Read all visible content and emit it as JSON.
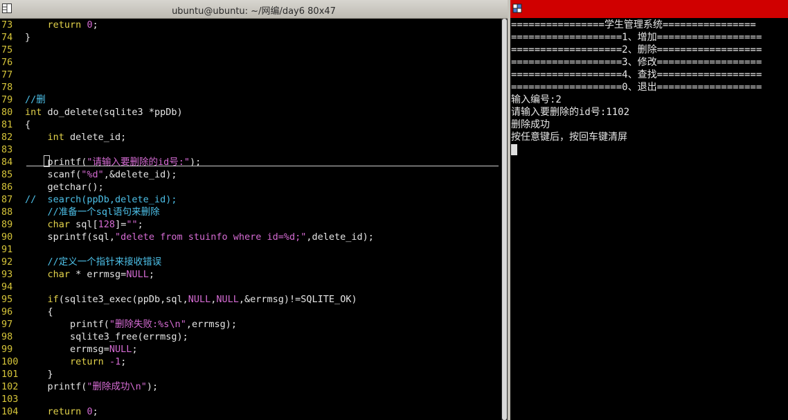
{
  "window": {
    "title": "ubuntu@ubuntu: ~/网编/day6 80x47"
  },
  "colors": {
    "right_titlebar": "#d00000",
    "line_number": "#d7c63a",
    "keyword": "#e3d34b",
    "string": "#d56bd3",
    "comment": "#4dc0e8"
  },
  "code_lines": [
    {
      "n": "73",
      "parts": [
        [
          "ct",
          "    "
        ],
        [
          "kw",
          "return"
        ],
        [
          "ct",
          " "
        ],
        [
          "num",
          "0"
        ],
        [
          "ct",
          ";"
        ]
      ]
    },
    {
      "n": "74",
      "parts": [
        [
          "ct",
          "}"
        ]
      ]
    },
    {
      "n": "75",
      "parts": []
    },
    {
      "n": "76",
      "parts": []
    },
    {
      "n": "77",
      "parts": []
    },
    {
      "n": "78",
      "parts": []
    },
    {
      "n": "79",
      "parts": [
        [
          "cmt",
          "//删"
        ]
      ]
    },
    {
      "n": "80",
      "parts": [
        [
          "kw",
          "int"
        ],
        [
          "ct",
          " do_delete(sqlite3 *ppDb)"
        ]
      ]
    },
    {
      "n": "81",
      "parts": [
        [
          "ct",
          "{"
        ]
      ]
    },
    {
      "n": "82",
      "parts": [
        [
          "ct",
          "    "
        ],
        [
          "kw",
          "int"
        ],
        [
          "ct",
          " delete_id;"
        ]
      ]
    },
    {
      "n": "83",
      "parts": []
    },
    {
      "n": "84",
      "parts": [
        [
          "ct",
          "    printf("
        ],
        [
          "str",
          "\"请输入要删除的id号:\""
        ],
        [
          "ct",
          ");"
        ]
      ]
    },
    {
      "n": "85",
      "parts": [
        [
          "ct",
          "    scanf("
        ],
        [
          "str",
          "\"%d\""
        ],
        [
          "ct",
          ",&delete_id);"
        ]
      ]
    },
    {
      "n": "86",
      "parts": [
        [
          "ct",
          "    getchar();"
        ]
      ]
    },
    {
      "n": "87",
      "parts": [
        [
          "cmt",
          "//  search(ppDb,delete_id);"
        ]
      ]
    },
    {
      "n": "88",
      "parts": [
        [
          "ct",
          "    "
        ],
        [
          "cmt",
          "//准备一个sql语句来删除"
        ]
      ]
    },
    {
      "n": "89",
      "parts": [
        [
          "ct",
          "    "
        ],
        [
          "kw",
          "char"
        ],
        [
          "ct",
          " sql["
        ],
        [
          "num",
          "128"
        ],
        [
          "ct",
          "]="
        ],
        [
          "str",
          "\"\""
        ],
        [
          "ct",
          ";"
        ]
      ]
    },
    {
      "n": "90",
      "parts": [
        [
          "ct",
          "    sprintf(sql,"
        ],
        [
          "str",
          "\"delete from stuinfo where id=%d;\""
        ],
        [
          "ct",
          ",delete_id);"
        ]
      ]
    },
    {
      "n": "91",
      "parts": []
    },
    {
      "n": "92",
      "parts": [
        [
          "ct",
          "    "
        ],
        [
          "cmt",
          "//定义一个指针来接收错误"
        ]
      ]
    },
    {
      "n": "93",
      "parts": [
        [
          "ct",
          "    "
        ],
        [
          "kw",
          "char"
        ],
        [
          "ct",
          " * errmsg="
        ],
        [
          "num",
          "NULL"
        ],
        [
          "ct",
          ";"
        ]
      ]
    },
    {
      "n": "94",
      "parts": []
    },
    {
      "n": "95",
      "parts": [
        [
          "ct",
          "    "
        ],
        [
          "kw",
          "if"
        ],
        [
          "ct",
          "(sqlite3_exec(ppDb,sql,"
        ],
        [
          "num",
          "NULL"
        ],
        [
          "ct",
          ","
        ],
        [
          "num",
          "NULL"
        ],
        [
          "ct",
          ",&errmsg)!=SQLITE_OK)"
        ]
      ]
    },
    {
      "n": "96",
      "parts": [
        [
          "ct",
          "    {"
        ]
      ]
    },
    {
      "n": "97",
      "parts": [
        [
          "ct",
          "        printf("
        ],
        [
          "str",
          "\"删除失败:%s\\n\""
        ],
        [
          "ct",
          ",errmsg);"
        ]
      ]
    },
    {
      "n": "98",
      "parts": [
        [
          "ct",
          "        sqlite3_free(errmsg);"
        ]
      ]
    },
    {
      "n": "99",
      "parts": [
        [
          "ct",
          "        errmsg="
        ],
        [
          "num",
          "NULL"
        ],
        [
          "ct",
          ";"
        ]
      ]
    },
    {
      "n": "100",
      "parts": [
        [
          "ct",
          "        "
        ],
        [
          "kw",
          "return"
        ],
        [
          "ct",
          " "
        ],
        [
          "num",
          "-1"
        ],
        [
          "ct",
          ";"
        ]
      ]
    },
    {
      "n": "101",
      "parts": [
        [
          "ct",
          "    }"
        ]
      ]
    },
    {
      "n": "102",
      "parts": [
        [
          "ct",
          "    printf("
        ],
        [
          "str",
          "\"删除成功\\n\""
        ],
        [
          "ct",
          ");"
        ]
      ]
    },
    {
      "n": "103",
      "parts": []
    },
    {
      "n": "104",
      "parts": [
        [
          "ct",
          "    "
        ],
        [
          "kw",
          "return"
        ],
        [
          "ct",
          " "
        ],
        [
          "num",
          "0"
        ],
        [
          "ct",
          ";"
        ]
      ]
    }
  ],
  "console_lines": [
    "================学生管理系统================",
    "===================1、增加==================",
    "===================2、删除==================",
    "===================3、修改==================",
    "===================4、查找==================",
    "===================0、退出==================",
    "输入编号:2",
    "请输入要删除的id号:1102",
    "删除成功",
    "按任意键后，按回车键清屏"
  ]
}
